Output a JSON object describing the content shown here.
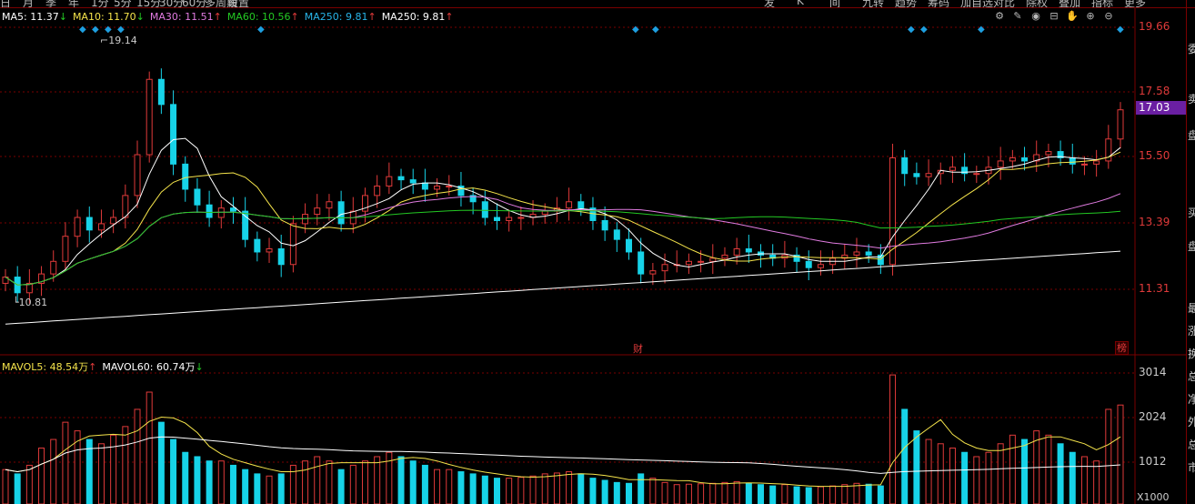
{
  "toolbar": {
    "items": [
      "日",
      "月",
      "季",
      "年",
      "1分",
      "5分",
      "15分",
      "30分",
      "60分",
      "多周期",
      "设置",
      "发",
      "K",
      "间",
      "九转",
      "趋势",
      "筹码",
      "加自选",
      "对比",
      "除权",
      "叠加",
      "指标",
      "更多"
    ]
  },
  "ma_legend": [
    {
      "label": "MA5: 11.37",
      "arrow": "↓",
      "color": "#ffffff"
    },
    {
      "label": "MA10: 11.70",
      "arrow": "↓",
      "color": "#f5e44b"
    },
    {
      "label": "MA30: 11.51",
      "arrow": "↑",
      "color": "#e07be0"
    },
    {
      "label": "MA60: 10.56",
      "arrow": "↑",
      "color": "#23c823"
    },
    {
      "label": "MA250: 9.81",
      "arrow": "↑",
      "color": "#28b4e8"
    },
    {
      "label": "MA250: 9.81",
      "arrow": "↑",
      "color": "#ffffff"
    }
  ],
  "vol_legend": [
    {
      "label": "MAVOL5: 48.54万",
      "arrow": "↑",
      "color": "#f5e44b"
    },
    {
      "label": "MAVOL60: 60.74万",
      "arrow": "↓",
      "color": "#ffffff"
    }
  ],
  "tool_icons": [
    "gear-icon",
    "pencil-icon",
    "eye-icon",
    "lock-icon",
    "hand-icon",
    "zoom-in-icon",
    "zoom-out-icon"
  ],
  "price_axis": [
    "19.66",
    "17.58",
    "15.50",
    "13.39",
    "11.31"
  ],
  "current_price": "17.03",
  "vol_axis": [
    "3014",
    "2024",
    "1012"
  ],
  "vol_unit": "X1000",
  "high_label": "19.14",
  "low_label": "10.81",
  "tags": {
    "fin": "财",
    "rank": "榜"
  },
  "right_panel_chars": [
    "委",
    "卖",
    "盘",
    "买",
    "盘",
    "最",
    "涨",
    "换",
    "总",
    "净",
    "外",
    "总",
    "市"
  ],
  "colors": {
    "up": "#e03a3a",
    "down": "#17d3e8",
    "ma5": "#ffffff",
    "ma10": "#f5e44b",
    "ma30": "#e07be0",
    "ma60": "#23c823",
    "ma250": "#ffffff",
    "grid": "#7a0000"
  },
  "chart_data": {
    "type": "candlestick",
    "price_ticks": [
      19.66,
      17.58,
      15.5,
      13.39,
      11.31
    ],
    "volume_ticks": [
      3014,
      2024,
      1012
    ],
    "volume_unit": "X1000",
    "high": 19.14,
    "low": 10.81,
    "last": 17.03,
    "closes": [
      11.7,
      11.2,
      11.5,
      11.8,
      12.2,
      13.0,
      13.6,
      13.2,
      13.4,
      13.6,
      14.3,
      15.6,
      18.0,
      17.2,
      15.3,
      14.5,
      14.0,
      13.6,
      13.9,
      13.8,
      12.9,
      12.5,
      12.6,
      12.1,
      13.4,
      13.7,
      13.9,
      14.1,
      13.4,
      13.8,
      14.3,
      14.6,
      14.9,
      14.8,
      14.7,
      14.5,
      14.6,
      14.6,
      14.3,
      14.1,
      13.6,
      13.5,
      13.6,
      13.6,
      13.7,
      13.8,
      13.9,
      14.1,
      13.9,
      13.5,
      13.2,
      12.9,
      12.5,
      11.8,
      11.9,
      12.1,
      12.1,
      12.2,
      12.2,
      12.3,
      12.4,
      12.6,
      12.5,
      12.4,
      12.3,
      12.4,
      12.2,
      12.0,
      12.1,
      12.3,
      12.4,
      12.5,
      12.4,
      12.1,
      15.5,
      15.0,
      14.9,
      15.0,
      15.1,
      15.2,
      15.0,
      15.0,
      15.2,
      15.4,
      15.5,
      15.4,
      15.6,
      15.7,
      15.5,
      15.3,
      15.3,
      15.4,
      16.1,
      17.03
    ],
    "volumes": [
      800,
      700,
      900,
      1300,
      1500,
      1900,
      1700,
      1500,
      1400,
      1600,
      1800,
      2200,
      2600,
      1900,
      1500,
      1200,
      1100,
      1000,
      1000,
      900,
      800,
      700,
      650,
      700,
      900,
      1000,
      1100,
      1000,
      800,
      900,
      1000,
      1100,
      1200,
      1100,
      1000,
      900,
      800,
      800,
      750,
      700,
      650,
      600,
      600,
      620,
      650,
      700,
      720,
      750,
      700,
      600,
      550,
      500,
      480,
      700,
      600,
      500,
      450,
      460,
      470,
      480,
      500,
      520,
      480,
      450,
      420,
      450,
      400,
      380,
      400,
      420,
      450,
      480,
      460,
      420,
      3000,
      2200,
      1700,
      1500,
      1400,
      1300,
      1200,
      1100,
      1200,
      1400,
      1600,
      1500,
      1700,
      1600,
      1400,
      1200,
      1100,
      1000,
      2200,
      2300
    ]
  }
}
